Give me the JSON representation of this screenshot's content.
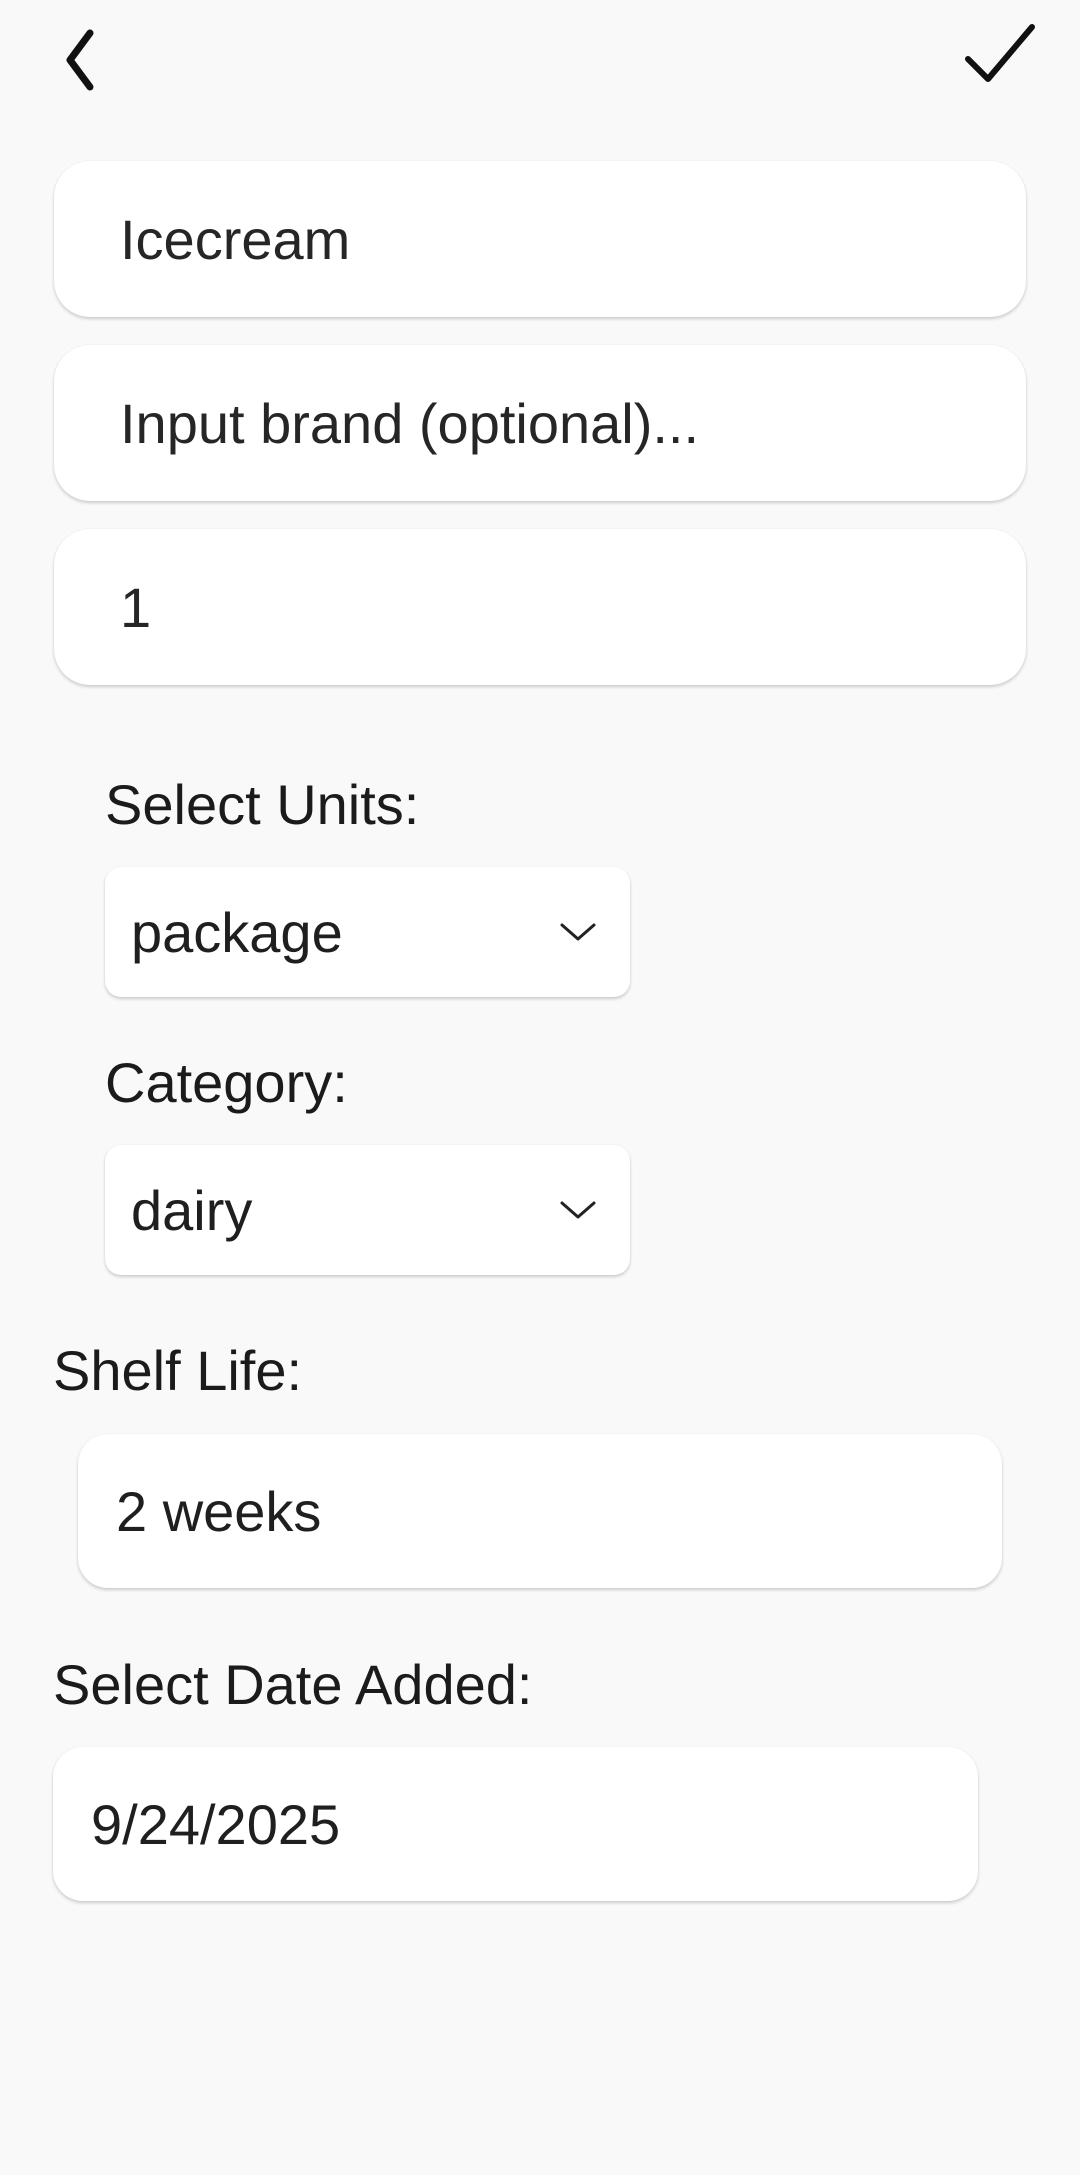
{
  "toolbar": {
    "back_icon": "chevron-left-icon",
    "confirm_icon": "checkmark-icon"
  },
  "form": {
    "name_value": "Icecream",
    "brand_placeholder": "Input brand (optional)...",
    "quantity_value": "1",
    "units_label": "Select Units:",
    "units_value": "package",
    "category_label": "Category:",
    "category_value": "dairy",
    "shelf_life_label": "Shelf Life:",
    "shelf_life_value": "2 weeks",
    "date_added_label": "Select Date Added:",
    "date_added_value": "9/24/2025"
  }
}
